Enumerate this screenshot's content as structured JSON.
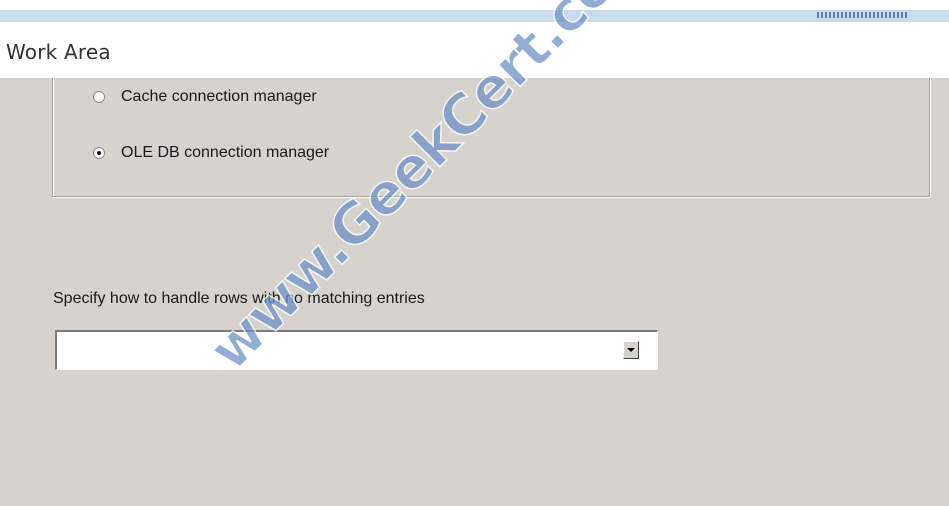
{
  "header": {
    "title": "Work Area"
  },
  "connection_type": {
    "options": [
      {
        "label": "Cache connection manager",
        "selected": false
      },
      {
        "label": "OLE DB connection manager",
        "selected": true
      }
    ]
  },
  "no_match": {
    "label": "Specify how to handle rows with no matching entries",
    "selected_value": ""
  },
  "watermark": {
    "text": "www.GeekCert.com"
  },
  "colors": {
    "panel_bg": "#d6d3ce",
    "header_band": "#c9daee",
    "watermark": "#6e91c8"
  }
}
